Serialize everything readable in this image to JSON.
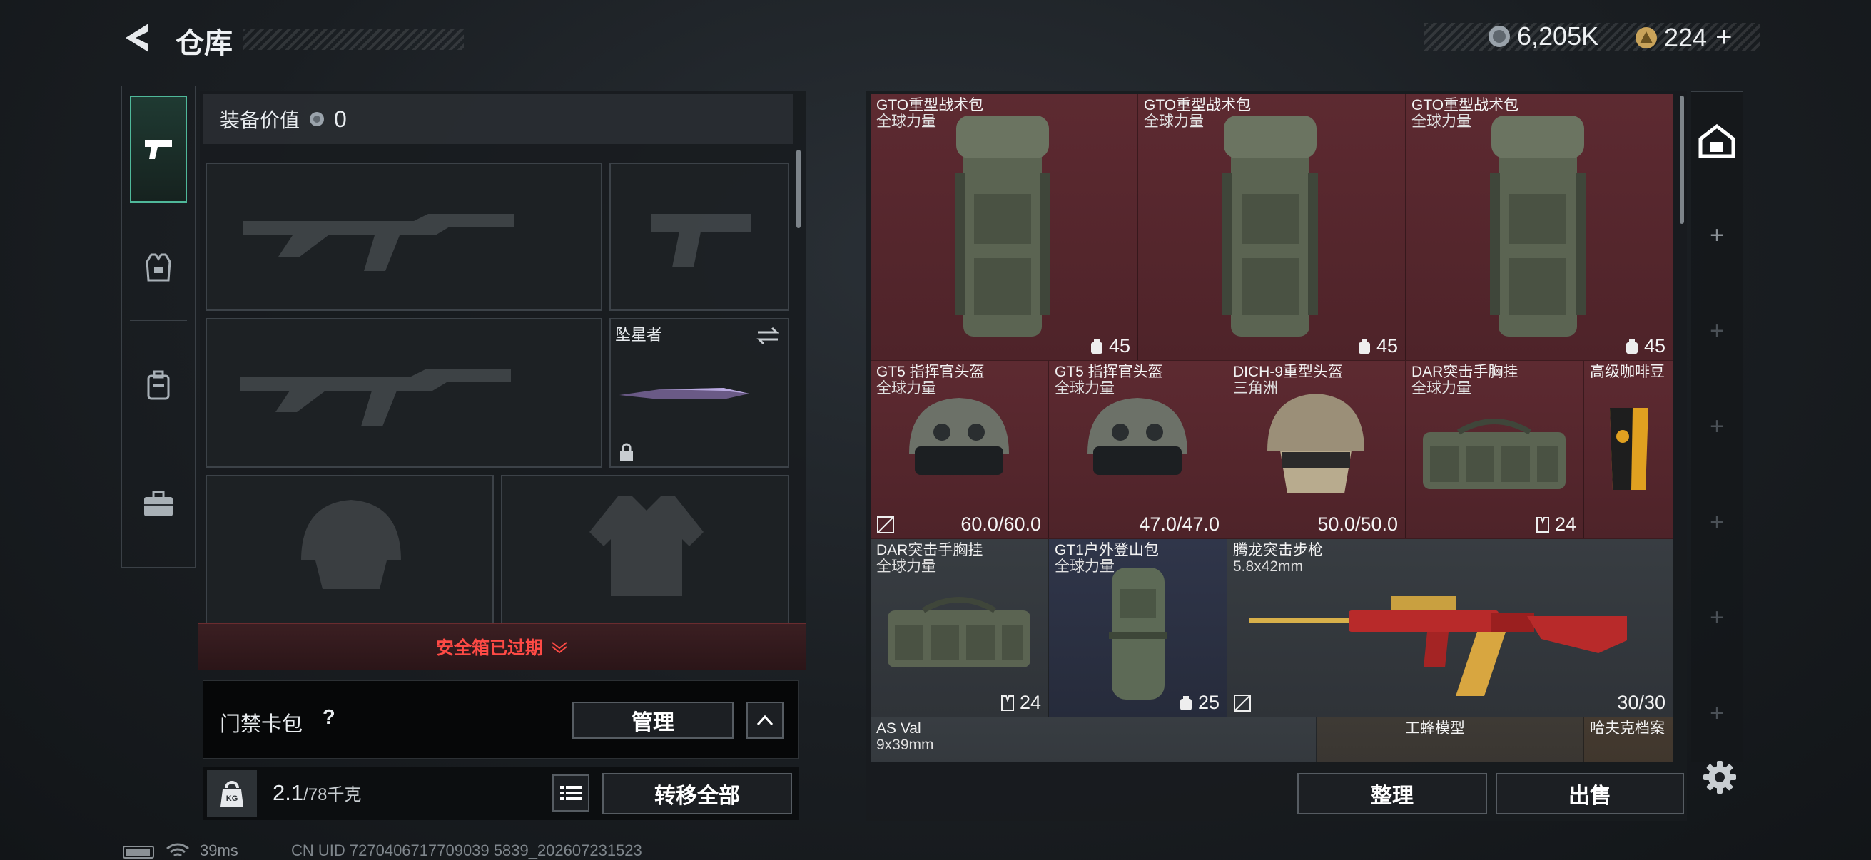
{
  "header": {
    "title": "仓库",
    "currency_silver": "6,205K",
    "currency_gold": "224",
    "add": "+"
  },
  "left": {
    "equip_value_label": "装备价值",
    "equip_value": "0",
    "melee_slot_label": "坠星者",
    "safebox_status": "安全箱已过期",
    "card_pack_label": "门禁卡包",
    "card_pack_help": "?",
    "manage_button": "管理",
    "weight_icon": "KG",
    "weight_current": "2.1",
    "weight_max": "/78千克",
    "transfer_all_button": "转移全部"
  },
  "grid": {
    "items": [
      {
        "name": "GTO重型战术包",
        "sub": "全球力量",
        "value": "45",
        "color": "red"
      },
      {
        "name": "GTO重型战术包",
        "sub": "全球力量",
        "value": "45",
        "color": "red"
      },
      {
        "name": "GTO重型战术包",
        "sub": "全球力量",
        "value": "45",
        "color": "red"
      },
      {
        "name": "GT5 指挥官头盔",
        "sub": "全球力量",
        "value": "60.0/60.0",
        "color": "red"
      },
      {
        "name": "GT5 指挥官头盔",
        "sub": "全球力量",
        "value": "47.0/47.0",
        "color": "red"
      },
      {
        "name": "DICH-9重型头盔",
        "sub": "三角洲",
        "value": "50.0/50.0",
        "color": "red"
      },
      {
        "name": "DAR突击手胸挂",
        "sub": "全球力量",
        "value": "24",
        "color": "red"
      },
      {
        "name": "高级咖啡豆",
        "sub": "",
        "value": "",
        "color": "red"
      },
      {
        "name": "DAR突击手胸挂",
        "sub": "全球力量",
        "value": "24",
        "color": "gray"
      },
      {
        "name": "GT1户外登山包",
        "sub": "全球力量",
        "value": "25",
        "color": "navy"
      },
      {
        "name": "腾龙突击步枪",
        "sub": "5.8x42mm",
        "value": "30/30",
        "color": "gray"
      },
      {
        "name": "AS Val",
        "sub": "9x39mm",
        "value": "",
        "color": "gray"
      },
      {
        "name": "工蜂模型",
        "sub": "",
        "value": "",
        "color": "gray"
      },
      {
        "name": "哈夫克档案",
        "sub": "",
        "value": "",
        "color": "gray"
      }
    ]
  },
  "bottom_right": {
    "sort_button": "整理",
    "sell_button": "出售"
  },
  "status": {
    "ping": "39ms",
    "uid": "CN UID 7270406717709039 5839_202607231523"
  },
  "colors": {
    "accent": "#4fb89a",
    "danger": "#e0443c",
    "rare_red": "#5d2a31"
  }
}
